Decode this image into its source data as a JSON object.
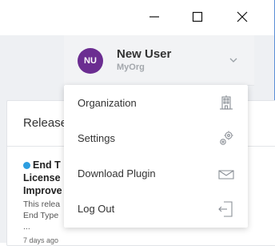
{
  "window": {
    "minimize_symbol": "—",
    "maximize_symbol": "□",
    "close_symbol": "✕"
  },
  "user": {
    "initials": "NU",
    "name": "New User",
    "org": "MyOrg",
    "avatar_color": "#6b2d91"
  },
  "menu": {
    "items": [
      {
        "label": "Organization",
        "icon": "building-icon"
      },
      {
        "label": "Settings",
        "icon": "gears-icon"
      },
      {
        "label": "Download Plugin",
        "icon": "tray-download-icon"
      },
      {
        "label": "Log Out",
        "icon": "logout-door-icon"
      }
    ]
  },
  "card": {
    "header": "Releases",
    "release": {
      "title_lines": [
        "End T",
        "License",
        "Improve"
      ],
      "desc_lines": [
        "This relea",
        "End Type",
        "..."
      ],
      "time": "7 days ago"
    }
  },
  "colors": {
    "accent_dot": "#2d9ee0",
    "window_border": "#5b8fd6"
  }
}
